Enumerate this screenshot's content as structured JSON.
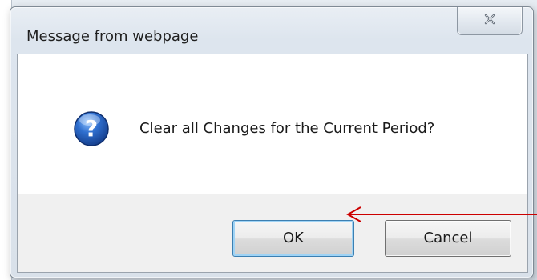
{
  "dialog": {
    "title": "Message from webpage",
    "close_icon": "close-x-icon",
    "message_icon": "question-icon",
    "message": "Clear all Changes for the Current Period?",
    "ok_label": "OK",
    "cancel_label": "Cancel"
  },
  "annotation": {
    "arrow_icon": "red-arrow-icon",
    "color": "#cc0000"
  },
  "colors": {
    "question_icon": "#2f6fcf",
    "dialog_frame": "#d9e1ea",
    "client_bg": "#ffffff",
    "button_bar": "#f0f0f0"
  }
}
